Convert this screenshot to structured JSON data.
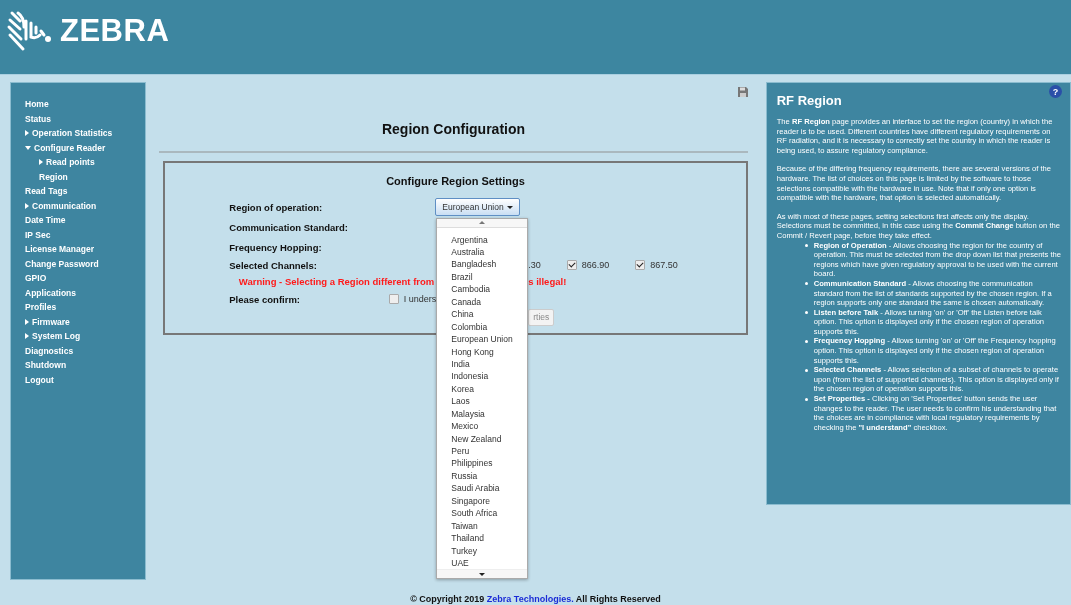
{
  "header": {
    "brand": "ZEBRA"
  },
  "sidebar": {
    "items": [
      {
        "label": "Home"
      },
      {
        "label": "Status"
      },
      {
        "label": "Operation Statistics",
        "expanded": false
      },
      {
        "label": "Configure Reader",
        "expanded": true,
        "children": [
          {
            "label": "Read points",
            "expanded": false
          },
          {
            "label": "Region"
          }
        ]
      },
      {
        "label": "Read Tags"
      },
      {
        "label": "Communication",
        "expanded": false
      },
      {
        "label": "Date Time"
      },
      {
        "label": "IP Sec"
      },
      {
        "label": "License Manager"
      },
      {
        "label": "Change Password"
      },
      {
        "label": "GPIO"
      },
      {
        "label": "Applications"
      },
      {
        "label": "Profiles"
      },
      {
        "label": "Firmware",
        "expanded": false
      },
      {
        "label": "System Log",
        "expanded": false
      },
      {
        "label": "Diagnostics"
      },
      {
        "label": "Shutdown"
      },
      {
        "label": "Logout"
      }
    ]
  },
  "main": {
    "title": "Region Configuration",
    "form": {
      "title": "Configure Region Settings",
      "labels": {
        "region": "Region of operation:",
        "standard": "Communication Standard:",
        "hopping": "Frequency Hopping:",
        "channels": "Selected Channels:",
        "confirm": "Please confirm:"
      },
      "region_select": {
        "value": "European Union",
        "expanded": true,
        "options": [
          "Argentina",
          "Australia",
          "Bangladesh",
          "Brazil",
          "Cambodia",
          "Canada",
          "China",
          "Colombia",
          "European Union",
          "Hong Kong",
          "India",
          "Indonesia",
          "Korea",
          "Laos",
          "Malaysia",
          "Mexico",
          "New Zealand",
          "Peru",
          "Philippines",
          "Russia",
          "Saudi Arabia",
          "Singapore",
          "South Africa",
          "Taiwan",
          "Thailand",
          "Turkey",
          "UAE"
        ]
      },
      "channels": [
        {
          "kind": "text",
          "label": ".30"
        },
        {
          "kind": "checkbox",
          "label": "866.90",
          "checked": true
        },
        {
          "kind": "checkbox",
          "label": "867.50",
          "checked": true
        }
      ],
      "warning": [
        "Warning - Selecting a Region different from",
        "s illegal!"
      ],
      "confirm": {
        "label": "I unders",
        "checked": false
      },
      "set_button": {
        "label": "rties",
        "disabled": true
      }
    }
  },
  "help": {
    "button": "?",
    "title": "RF Region",
    "paragraphs": [
      "The **RF Region** page provides an interface to set the region (country) in which the reader is to be used. Different countries have different regulatory requirements on RF radiation, and it is necessary to correctly set the country in which the reader is being used, to assure regulatory compliance.",
      "Because of the differing frequency requirements, there are several versions of the hardware. The list of choices on this page is limited by the software to those selections compatible with the hardware in use. Note that if only one option is compatible with the hardware, that option is selected automatically.",
      "As with most of these pages, setting selections first affects only the display. Selections must be committed, in this case using the **Commit Change** button on the Commit / Revert page, before they take effect."
    ],
    "bullets": [
      "**Region of Operation** - Allows choosing the region for the country of operation. This must be selected from the drop down list that presents the regions which have given regulatory approval to be used with the current board.",
      "**Communication Standard** - Allows choosing the communication standard from the list of standards supported by the chosen region. If a region supports only one standard the same is chosen automatically.",
      "**Listen before Talk** - Allows turning 'on' or 'Off' the Listen before talk option. This option is displayed only if the chosen region of operation supports this.",
      "**Frequency Hopping** - Allows turning 'on' or 'Off' the Frequency hopping option. This option is displayed only if the chosen region of operation supports this.",
      "**Selected Channels** - Allows selection of a subset of channels to operate upon (from the list of supported channels). This option is displayed only if the chosen region of operation supports this.",
      "**Set Properties -** Clicking on 'Set Properties' button sends the user changes to the reader. The user needs to confirm his understanding that the choices are in compliance with local regulatory requirements by checking the **\"I understand\"** checkbox."
    ]
  },
  "footer": {
    "prefix": "© Copyright 2019 ",
    "link": "Zebra Technologies.",
    "suffix": " All Rights Reserved"
  }
}
